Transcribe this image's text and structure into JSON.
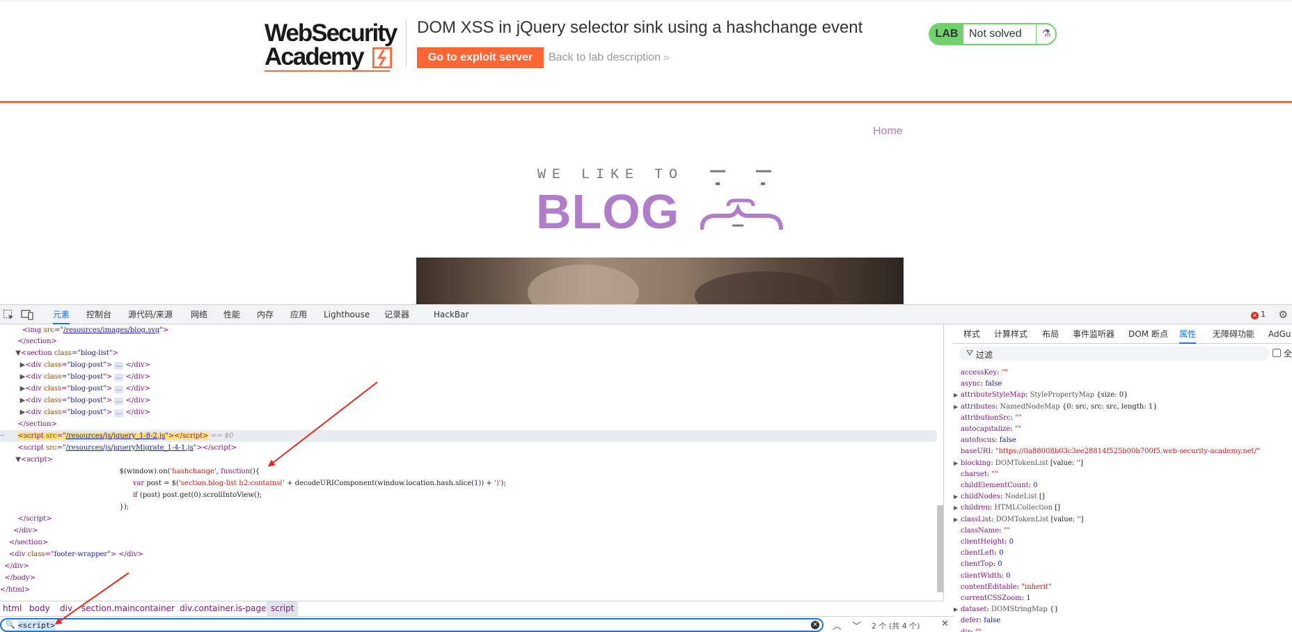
{
  "site": {
    "logo_line1": "WebSecurity",
    "logo_line2": "Academy",
    "lab_title": "DOM XSS in jQuery selector sink using a hashchange event",
    "exploit_button": "Go to exploit server",
    "back_link": "Back to lab description",
    "back_link_chevron": "»",
    "lab_label": "LAB",
    "lab_status": "Not solved",
    "flask_icon": "⚗",
    "nav_home": "Home",
    "blog_small": "WE LIKE TO",
    "blog_big": "BLOG",
    "colors": {
      "accent": "#ff6633",
      "lab_green": "#70d16d",
      "blog_purple": "#b07ec8"
    }
  },
  "devtools": {
    "tabs": [
      "元素",
      "控制台",
      "源代码/来源",
      "网络",
      "性能",
      "内存",
      "应用",
      "Lighthouse",
      "记录器",
      "HackBar"
    ],
    "active_tab": "元素",
    "error_count": "1",
    "elements": {
      "l1_src": "/resources/images/blog.svg",
      "l3_class": "blog-list",
      "post_class": "blog-post",
      "ellipsis": "…",
      "script1_src": "/resources/js/jquery_1-8-2.js",
      "eq0": "== $0",
      "script2_src": "/resources/js/jqueryMigrate_1-4-1.js",
      "js_l1_a": "$(window).on(",
      "js_l1_b": "'hashchange'",
      "js_l1_c": ", ",
      "js_l1_d": "function",
      "js_l1_e": "(){",
      "js_l2_a": "var",
      "js_l2_b": " post = $(",
      "js_l2_c": "'section.blog-list h2:contains('",
      "js_l2_d": " + decodeURIComponent(window.location.hash.slice(",
      "js_l2_e": "1",
      "js_l2_f": ")) + ",
      "js_l2_g": "')'",
      "js_l2_h": ");",
      "js_l3_a": "if",
      "js_l3_b": " (post) post.get(",
      "js_l3_c": "0",
      "js_l3_d": ").scrollIntoView();",
      "js_l4": "});",
      "footer_class": "footer-wrapper"
    },
    "breadcrumbs": [
      "html",
      "body",
      "div",
      "section.maincontainer",
      "div.container.is-page",
      "script"
    ],
    "search": {
      "value": "<script>",
      "match_count": "2 个 (共 4 个)"
    },
    "side_tabs": [
      "样式",
      "计算样式",
      "布局",
      "事件监听器",
      "DOM 断点",
      "属性",
      "无障碍功能",
      "AdGu"
    ],
    "side_active": "属性",
    "filter_label": "过滤",
    "filter_check_label": "全",
    "properties": [
      {
        "key": "accessKey",
        "value": "\"\"",
        "kind": "string",
        "expand": false
      },
      {
        "key": "async",
        "value": "false",
        "kind": "bool",
        "expand": false
      },
      {
        "key": "attributeStyleMap",
        "value": "StylePropertyMap",
        "extra": "{size: 0}",
        "kind": "type",
        "expand": true
      },
      {
        "key": "attributes",
        "value": "NamedNodeMap",
        "extra": "{0: src, src: src, length: 1}",
        "kind": "type",
        "expand": true
      },
      {
        "key": "attributionSrc",
        "value": "\"\"",
        "kind": "string",
        "expand": false
      },
      {
        "key": "autocapitalize",
        "value": "\"\"",
        "kind": "string",
        "expand": false
      },
      {
        "key": "autofocus",
        "value": "false",
        "kind": "bool",
        "expand": false
      },
      {
        "key": "baseURI",
        "value": "\"https://0a88008b03c3ee28814f525b00b700f5.web-security-academy.net/\"",
        "kind": "string",
        "expand": false
      },
      {
        "key": "blocking",
        "value": "DOMTokenList",
        "extra": "[value: '']",
        "kind": "type",
        "expand": true
      },
      {
        "key": "charset",
        "value": "\"\"",
        "kind": "string",
        "expand": false
      },
      {
        "key": "childElementCount",
        "value": "0",
        "kind": "num",
        "expand": false
      },
      {
        "key": "childNodes",
        "value": "NodeList",
        "extra": "[]",
        "kind": "type",
        "expand": true
      },
      {
        "key": "children",
        "value": "HTMLCollection",
        "extra": "[]",
        "kind": "type",
        "expand": true
      },
      {
        "key": "classList",
        "value": "DOMTokenList",
        "extra": "[value: '']",
        "kind": "type",
        "expand": true
      },
      {
        "key": "className",
        "value": "\"\"",
        "kind": "string",
        "expand": false
      },
      {
        "key": "clientHeight",
        "value": "0",
        "kind": "num",
        "expand": false
      },
      {
        "key": "clientLeft",
        "value": "0",
        "kind": "num",
        "expand": false
      },
      {
        "key": "clientTop",
        "value": "0",
        "kind": "num",
        "expand": false
      },
      {
        "key": "clientWidth",
        "value": "0",
        "kind": "num",
        "expand": false
      },
      {
        "key": "contentEditable",
        "value": "\"inherit\"",
        "kind": "string",
        "expand": false
      },
      {
        "key": "currentCSSZoom",
        "value": "1",
        "kind": "num",
        "expand": false
      },
      {
        "key": "dataset",
        "value": "DOMStringMap",
        "extra": "{}",
        "kind": "type",
        "expand": true
      },
      {
        "key": "defer",
        "value": "false",
        "kind": "bool",
        "expand": false
      },
      {
        "key": "dir",
        "value": "\"\"",
        "kind": "string",
        "expand": false
      }
    ]
  }
}
